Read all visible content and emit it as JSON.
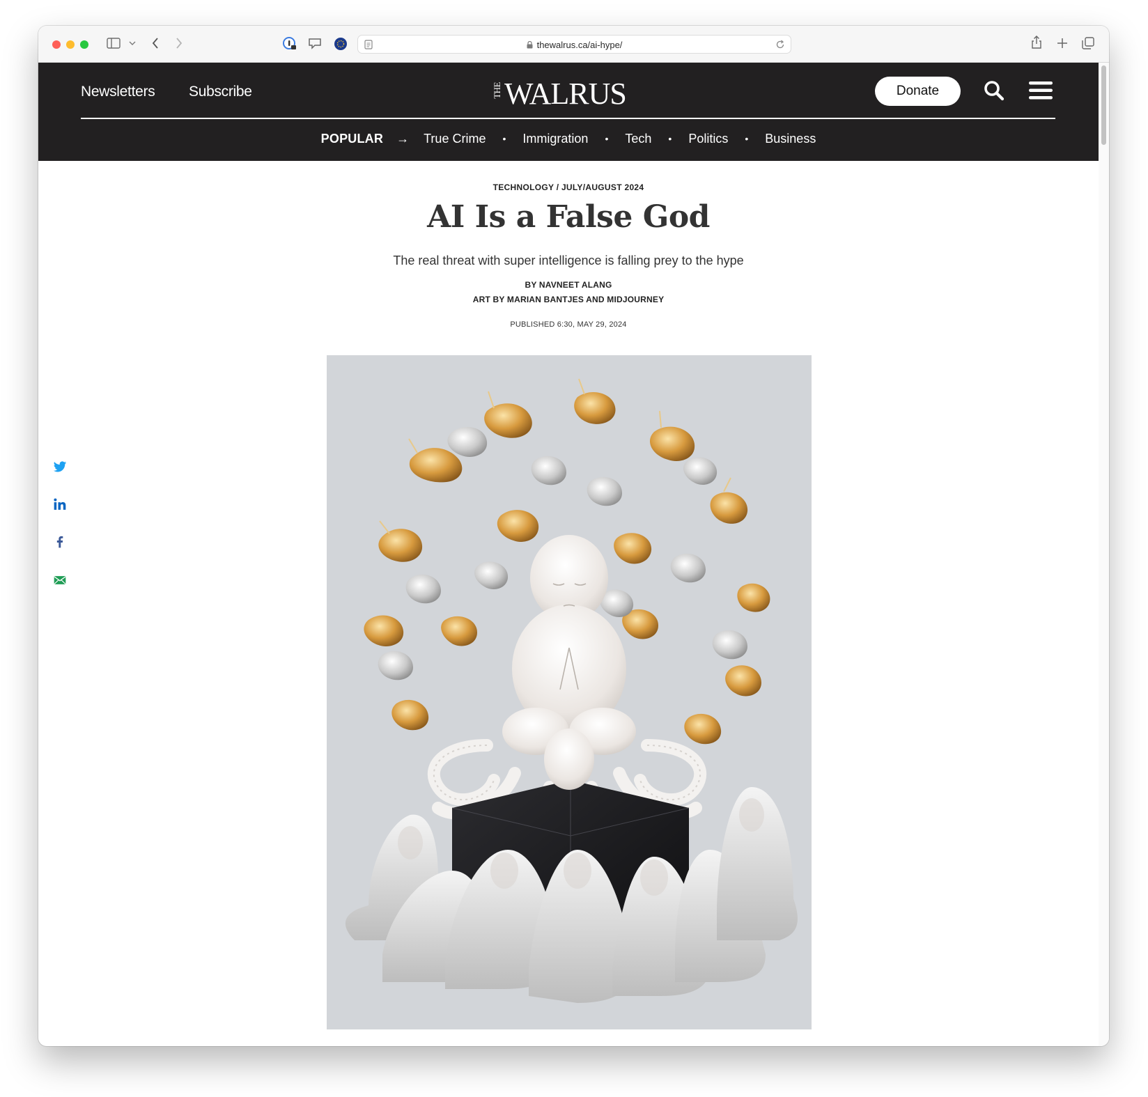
{
  "browser": {
    "url": "thewalrus.ca/ai-hype/"
  },
  "header": {
    "nav_left": [
      "Newsletters",
      "Subscribe"
    ],
    "logo_small": "THE",
    "logo_main": "WALRUS",
    "donate_label": "Donate",
    "popular_label": "POPULAR",
    "popular_arrow": "→",
    "popular_links": [
      "True Crime",
      "Immigration",
      "Tech",
      "Politics",
      "Business"
    ]
  },
  "article": {
    "kicker": "TECHNOLOGY / JULY/AUGUST 2024",
    "title": "AI Is a False God",
    "dek": "The real threat with super intelligence is falling prey to the hype",
    "byline": "BY NAVNEET ALANG",
    "art_credit": "ART BY MARIAN BANTJES AND MIDJOURNEY",
    "published": "PUBLISHED 6:30, MAY 29, 2024"
  },
  "share_icons": [
    "twitter-icon",
    "linkedin-icon",
    "facebook-icon",
    "email-icon"
  ],
  "colors": {
    "header_bg": "#222021",
    "twitter": "#1da1f2",
    "linkedin": "#0a66c2",
    "facebook": "#3b5998",
    "email": "#1f9d55",
    "hero_bg": "#d2d5d9"
  }
}
